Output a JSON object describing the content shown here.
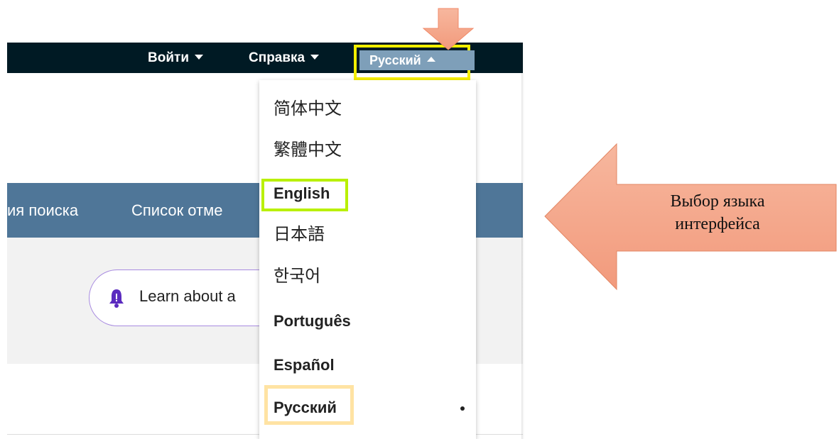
{
  "topbar": {
    "login": "Войти",
    "help": "Справка",
    "language": "Русский"
  },
  "navbar": {
    "search_history_partial": "ия поиска",
    "marked_list_partial": "Список отме"
  },
  "banner": {
    "learn_text_partial": "Learn about a"
  },
  "language_menu": {
    "items": [
      "简体中文",
      "繁體中文",
      "English",
      "日本語",
      "한국어",
      "Português",
      "Español",
      "Русский"
    ],
    "selected": "Русский"
  },
  "callout": {
    "text_line1": "Выбор языка",
    "text_line2": "интерфейса"
  },
  "colors": {
    "topbar_bg": "#001a24",
    "navbar_bg": "#4f7698",
    "highlight_yellow": "#f4ef00",
    "highlight_green": "#b9f000",
    "highlight_beige": "#ffe3a3",
    "arrow_fill": "#f4a589",
    "bell": "#5b2bbf"
  }
}
